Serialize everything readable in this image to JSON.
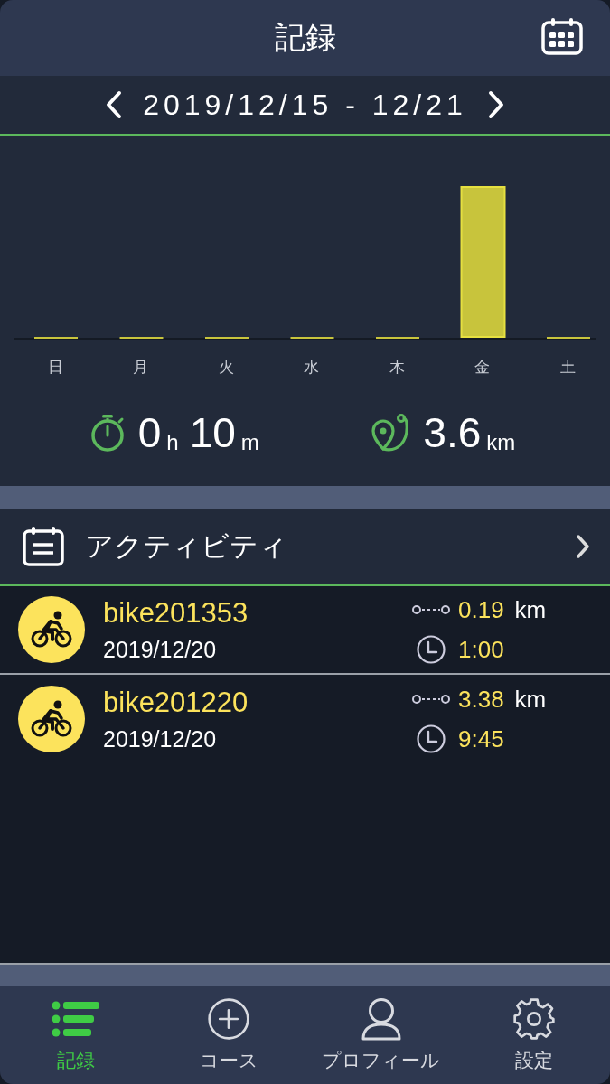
{
  "header": {
    "title": "記録"
  },
  "week": {
    "range": "2019/12/15 - 12/21"
  },
  "chart": {
    "days": [
      "日",
      "月",
      "火",
      "水",
      "木",
      "金",
      "土"
    ]
  },
  "summary": {
    "hours": "0",
    "hours_unit": "h",
    "minutes": "10",
    "minutes_unit": "m",
    "distance": "3.6",
    "distance_unit": "km"
  },
  "activity_section": {
    "title": "アクティビティ"
  },
  "activities": [
    {
      "name": "bike201353",
      "date": "2019/12/20",
      "distance": "0.19",
      "distance_unit": "km",
      "duration": "1:00"
    },
    {
      "name": "bike201220",
      "date": "2019/12/20",
      "distance": "3.38",
      "distance_unit": "km",
      "duration": "9:45"
    }
  ],
  "tabs": [
    {
      "kind": "list",
      "label": "記録",
      "selected": true
    },
    {
      "kind": "add",
      "label": "コース",
      "selected": false
    },
    {
      "kind": "profile",
      "label": "プロフィール",
      "selected": false
    },
    {
      "kind": "settings",
      "label": "設定",
      "selected": false
    }
  ]
}
